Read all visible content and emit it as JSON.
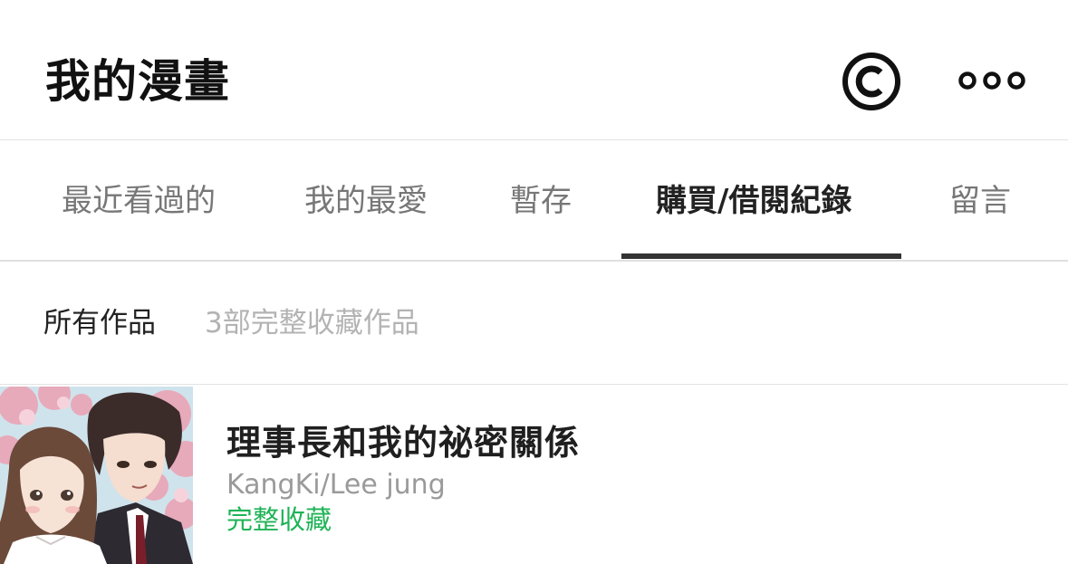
{
  "header": {
    "title": "我的漫畫",
    "coin_icon": "copyright-circle-icon",
    "more_icon": "more-dots-icon"
  },
  "tabs": [
    {
      "label": "最近看過的",
      "active": false
    },
    {
      "label": "我的最愛",
      "active": false
    },
    {
      "label": "暫存",
      "active": false
    },
    {
      "label": "購買/借閱紀錄",
      "active": true
    },
    {
      "label": "留言",
      "active": false
    }
  ],
  "filter": {
    "label": "所有作品",
    "count_text": "3部完整收藏作品"
  },
  "items": [
    {
      "title": "理事長和我的祕密關係",
      "author": "KangKi/Lee jung",
      "status": "完整收藏"
    }
  ],
  "colors": {
    "accent_green": "#1fb356",
    "tab_indicator": "#333333",
    "muted_text": "#9a9a9a"
  }
}
